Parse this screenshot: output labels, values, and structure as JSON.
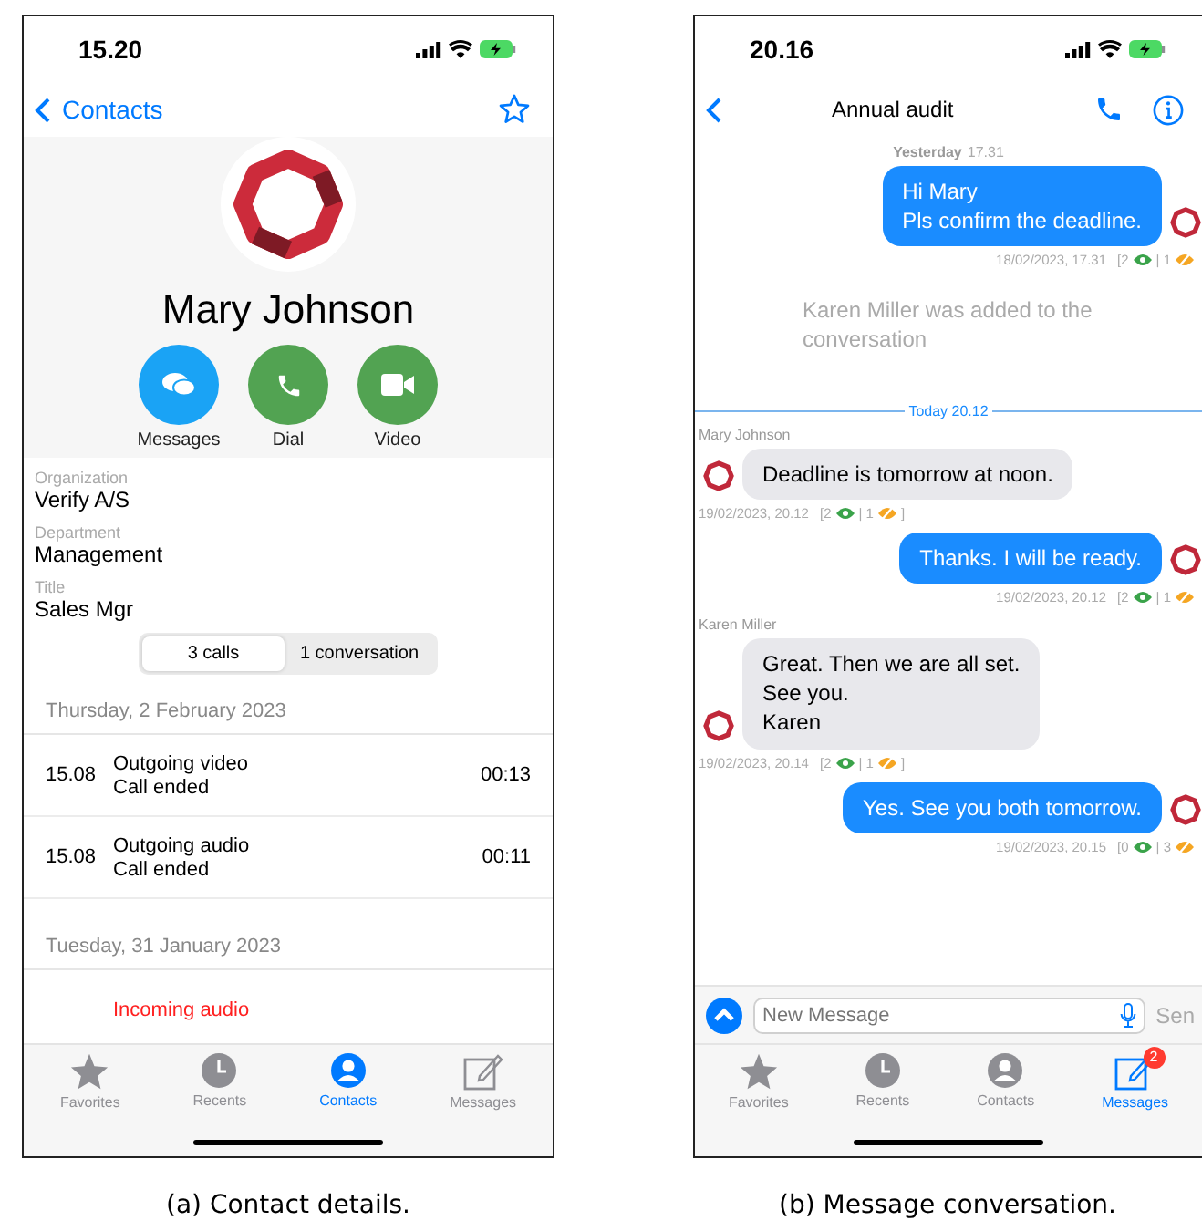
{
  "contact_screen": {
    "status_bar": {
      "time": "15.20"
    },
    "nav": {
      "back": "Contacts"
    },
    "name": "Mary Johnson",
    "actions": [
      {
        "kind": "messages",
        "label": "Messages"
      },
      {
        "kind": "dial",
        "label": "Dial"
      },
      {
        "kind": "video",
        "label": "Video"
      }
    ],
    "fields": [
      {
        "label": "Organization",
        "value": "Verify A/S"
      },
      {
        "label": "Department",
        "value": "Management"
      },
      {
        "label": "Title",
        "value": "Sales Mgr"
      }
    ],
    "segments": [
      {
        "label": "3 calls",
        "selected": true
      },
      {
        "label": "1 conversation",
        "selected": false
      }
    ],
    "call_groups": [
      {
        "date": "Thursday, 2 February 2023",
        "calls": [
          {
            "time": "15.08",
            "type": "Outgoing video",
            "status": "Call ended",
            "duration": "00:13",
            "missed": false
          },
          {
            "time": "15.08",
            "type": "Outgoing audio",
            "status": "Call ended",
            "duration": "00:11",
            "missed": false
          }
        ]
      },
      {
        "date": "Tuesday, 31 January 2023",
        "calls": [
          {
            "type": "Incoming audio",
            "missed": true
          }
        ]
      }
    ],
    "tab_bar": [
      {
        "kind": "favorites",
        "label": "Favorites",
        "selected": false
      },
      {
        "kind": "recents",
        "label": "Recents",
        "selected": false
      },
      {
        "kind": "contacts",
        "label": "Contacts",
        "selected": true
      },
      {
        "kind": "messages",
        "label": "Messages",
        "selected": false
      }
    ]
  },
  "conversation_screen": {
    "status_bar": {
      "time": "20.16"
    },
    "nav": {
      "title": "Annual audit"
    },
    "messages": [
      {
        "kind": "timestamp",
        "day": "Yesterday",
        "time": "17.31"
      },
      {
        "kind": "outgoing",
        "lines": [
          "Hi Mary",
          "Pls confirm the deadline."
        ],
        "meta": {
          "time": "18/02/2023, 17.31",
          "seen": "[2",
          "unseen": "| 1"
        }
      },
      {
        "kind": "system",
        "text": "Karen Miller was added to the conversation"
      },
      {
        "kind": "divider",
        "text": "Today 20.12"
      },
      {
        "kind": "incoming",
        "sender": "Mary Johnson",
        "lines": [
          "Deadline is tomorrow at noon."
        ],
        "meta": {
          "time": "19/02/2023, 20.12",
          "seen": "[2",
          "unseen": "| 1",
          "close": "]"
        }
      },
      {
        "kind": "outgoing",
        "lines": [
          "Thanks. I will be ready."
        ],
        "meta": {
          "time": "19/02/2023, 20.12",
          "seen": "[2",
          "unseen": "| 1"
        }
      },
      {
        "kind": "incoming",
        "sender": "Karen Miller",
        "lines": [
          "Great. Then we are all set.",
          "See you.",
          "Karen"
        ],
        "meta": {
          "time": "19/02/2023, 20.14",
          "seen": "[2",
          "unseen": "| 1",
          "close": "]"
        }
      },
      {
        "kind": "outgoing",
        "lines": [
          "Yes. See you both tomorrow."
        ],
        "meta": {
          "time": "19/02/2023, 20.15",
          "seen": "[0",
          "unseen": "| 3"
        }
      }
    ],
    "composer": {
      "placeholder": "New Message",
      "send": "Sen"
    },
    "tab_bar": [
      {
        "kind": "favorites",
        "label": "Favorites",
        "selected": false
      },
      {
        "kind": "recents",
        "label": "Recents",
        "selected": false
      },
      {
        "kind": "contacts",
        "label": "Contacts",
        "selected": false
      },
      {
        "kind": "messages",
        "label": "Messages",
        "selected": true,
        "badge": "2"
      }
    ]
  },
  "captions": [
    "(a) Contact details.",
    "(b) Message conversation."
  ]
}
